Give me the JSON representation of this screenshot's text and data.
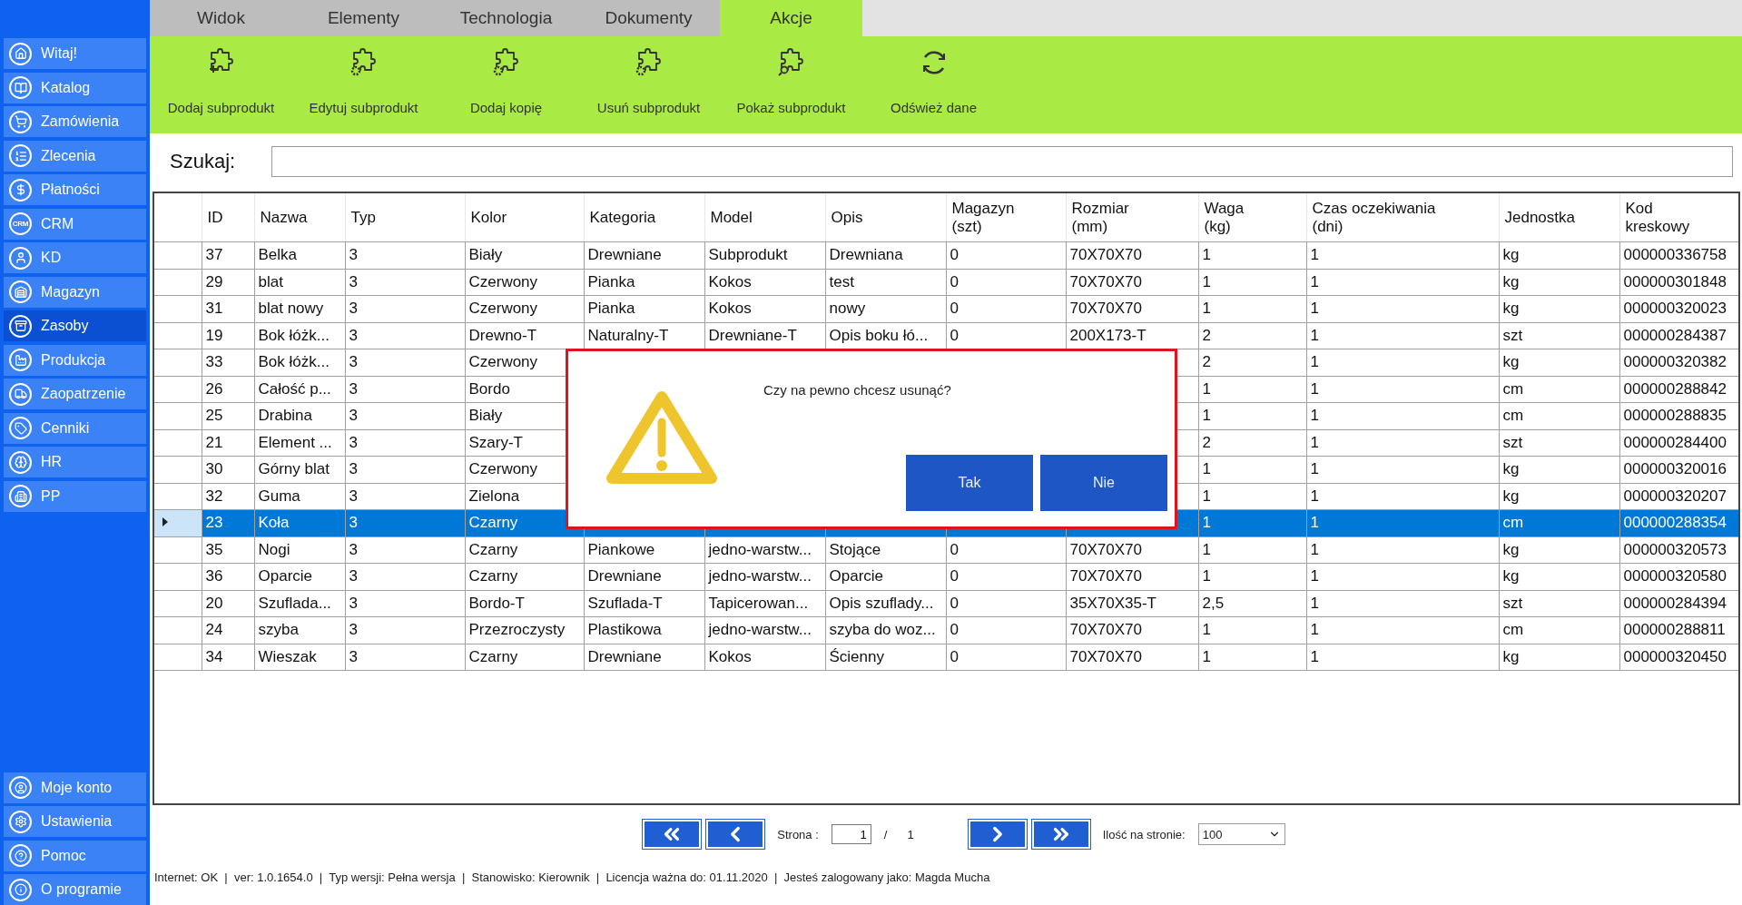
{
  "sidebar": {
    "items": [
      {
        "label": "Witaj!",
        "selected": false
      },
      {
        "label": "Katalog",
        "selected": false
      },
      {
        "label": "Zamówienia",
        "selected": false
      },
      {
        "label": "Zlecenia",
        "selected": false
      },
      {
        "label": "Płatności",
        "selected": false
      },
      {
        "label": "CRM",
        "selected": false,
        "badge": "CRM"
      },
      {
        "label": "KD",
        "selected": false
      },
      {
        "label": "Magazyn",
        "selected": false
      },
      {
        "label": "Zasoby",
        "selected": true
      },
      {
        "label": "Produkcja",
        "selected": false
      },
      {
        "label": "Zaopatrzenie",
        "selected": false
      },
      {
        "label": "Cenniki",
        "selected": false
      },
      {
        "label": "HR",
        "selected": false
      },
      {
        "label": "PP",
        "selected": false
      }
    ],
    "bottom_items": [
      {
        "label": "Moje konto",
        "selected": false
      },
      {
        "label": "Ustawienia",
        "selected": false
      },
      {
        "label": "Pomoc",
        "selected": false
      },
      {
        "label": "O programie",
        "selected": false
      }
    ]
  },
  "tabs": [
    {
      "label": "Widok",
      "selected": false
    },
    {
      "label": "Elementy",
      "selected": false
    },
    {
      "label": "Technologia",
      "selected": false
    },
    {
      "label": "Dokumenty",
      "selected": false
    },
    {
      "label": "Akcje",
      "selected": true
    }
  ],
  "toolbar": [
    {
      "label": "Dodaj subprodukt",
      "kind": "plus"
    },
    {
      "label": "Edytuj subprodukt",
      "kind": "gear"
    },
    {
      "label": "Dodaj kopię",
      "kind": "gear"
    },
    {
      "label": "Usuń subprodukt",
      "kind": "gear"
    },
    {
      "label": "Pokaż subprodukt",
      "kind": "magnifier"
    },
    {
      "label": "Odśwież dane",
      "kind": "refresh"
    }
  ],
  "search": {
    "label": "Szukaj:"
  },
  "table": {
    "columns": [
      "ID",
      "Nazwa",
      "Typ",
      "Kolor",
      "Kategoria",
      "Model",
      "Opis",
      "Magazyn\n(szt)",
      "Rozmiar\n(mm)",
      "Waga\n(kg)",
      "Czas oczekiwania\n(dni)",
      "Jednostka",
      "Kod\nkreskowy"
    ],
    "rows": [
      {
        "selected": false,
        "cells": [
          "37",
          "Belka",
          "3",
          "Biały",
          "Drewniane",
          "Subprodukt",
          "Drewniana",
          "0",
          "70X70X70",
          "1",
          "1",
          "kg",
          "000000336758"
        ]
      },
      {
        "selected": false,
        "cells": [
          "29",
          "blat",
          "3",
          "Czerwony",
          "Pianka",
          "Kokos",
          "test",
          "0",
          "70X70X70",
          "1",
          "1",
          "kg",
          "000000301848"
        ]
      },
      {
        "selected": false,
        "cells": [
          "31",
          "blat nowy",
          "3",
          "Czerwony",
          "Pianka",
          "Kokos",
          "nowy",
          "0",
          "70X70X70",
          "1",
          "1",
          "kg",
          "000000320023"
        ]
      },
      {
        "selected": false,
        "cells": [
          "19",
          "Bok łóżk...",
          "3",
          "Drewno-T",
          "Naturalny-T",
          "Drewniane-T",
          "Opis boku łó...",
          "0",
          "200X173-T",
          "2",
          "1",
          "szt",
          "000000284387"
        ]
      },
      {
        "selected": false,
        "cells": [
          "33",
          "Bok łóżk...",
          "3",
          "Czerwony",
          null,
          null,
          null,
          null,
          null,
          "2",
          "1",
          "kg",
          "000000320382"
        ]
      },
      {
        "selected": false,
        "cells": [
          "26",
          "Całość p...",
          "3",
          "Bordo",
          null,
          null,
          null,
          null,
          null,
          "1",
          "1",
          "cm",
          "000000288842"
        ]
      },
      {
        "selected": false,
        "cells": [
          "25",
          "Drabina",
          "3",
          "Biały",
          null,
          null,
          null,
          null,
          null,
          "1",
          "1",
          "cm",
          "000000288835"
        ]
      },
      {
        "selected": false,
        "cells": [
          "21",
          "Element ...",
          "3",
          "Szary-T",
          null,
          null,
          null,
          null,
          null,
          "2",
          "1",
          "szt",
          "000000284400"
        ]
      },
      {
        "selected": false,
        "cells": [
          "30",
          "Górny blat",
          "3",
          "Czerwony",
          null,
          null,
          null,
          null,
          null,
          "1",
          "1",
          "kg",
          "000000320016"
        ]
      },
      {
        "selected": false,
        "cells": [
          "32",
          "Guma",
          "3",
          "Zielona",
          null,
          null,
          null,
          null,
          null,
          "1",
          "1",
          "kg",
          "000000320207"
        ]
      },
      {
        "selected": true,
        "cells": [
          "23",
          "Koła",
          "3",
          "Czarny",
          null,
          null,
          null,
          null,
          null,
          "1",
          "1",
          "cm",
          "000000288354"
        ]
      },
      {
        "selected": false,
        "cells": [
          "35",
          "Nogi",
          "3",
          "Czarny",
          "Piankowe",
          "jedno-warstw...",
          "Stojące",
          "0",
          "70X70X70",
          "1",
          "1",
          "kg",
          "000000320573"
        ]
      },
      {
        "selected": false,
        "cells": [
          "36",
          "Oparcie",
          "3",
          "Czarny",
          "Drewniane",
          "jedno-warstw...",
          "Oparcie",
          "0",
          "70X70X70",
          "1",
          "1",
          "kg",
          "000000320580"
        ]
      },
      {
        "selected": false,
        "cells": [
          "20",
          "Szuflada...",
          "3",
          "Bordo-T",
          "Szuflada-T",
          "Tapicerowan...",
          "Opis szuflady...",
          "0",
          "35X70X35-T",
          "2,5",
          "1",
          "szt",
          "000000284394"
        ]
      },
      {
        "selected": false,
        "cells": [
          "24",
          "szyba",
          "3",
          "Przezroczysty",
          "Plastikowa",
          "jedno-warstw...",
          "szyba do woz...",
          "0",
          "70X70X70",
          "1",
          "1",
          "cm",
          "000000288811"
        ]
      },
      {
        "selected": false,
        "cells": [
          "34",
          "Wieszak",
          "3",
          "Czarny",
          "Drewniane",
          "Kokos",
          "Ścienny",
          "0",
          "70X70X70",
          "1",
          "1",
          "kg",
          "000000320450"
        ]
      }
    ]
  },
  "pagination": {
    "page_label": "Strona :",
    "page": "1",
    "separator": "/",
    "total": "1",
    "per_page_label": "Ilość na stronie:",
    "per_page": "100"
  },
  "dialog": {
    "message": "Czy na pewno chcesz usunąć?",
    "buttons": [
      "Tak",
      "Nie"
    ]
  },
  "status_bar": "Internet: OK  |  ver: 1.0.1654.0  |  Typ wersji: Pełna wersja  |  Stanowisko: Kierownik  |  Licencja ważna do: 01.11.2020  |  Jesteś zalogowany jako: Magda Mucha"
}
